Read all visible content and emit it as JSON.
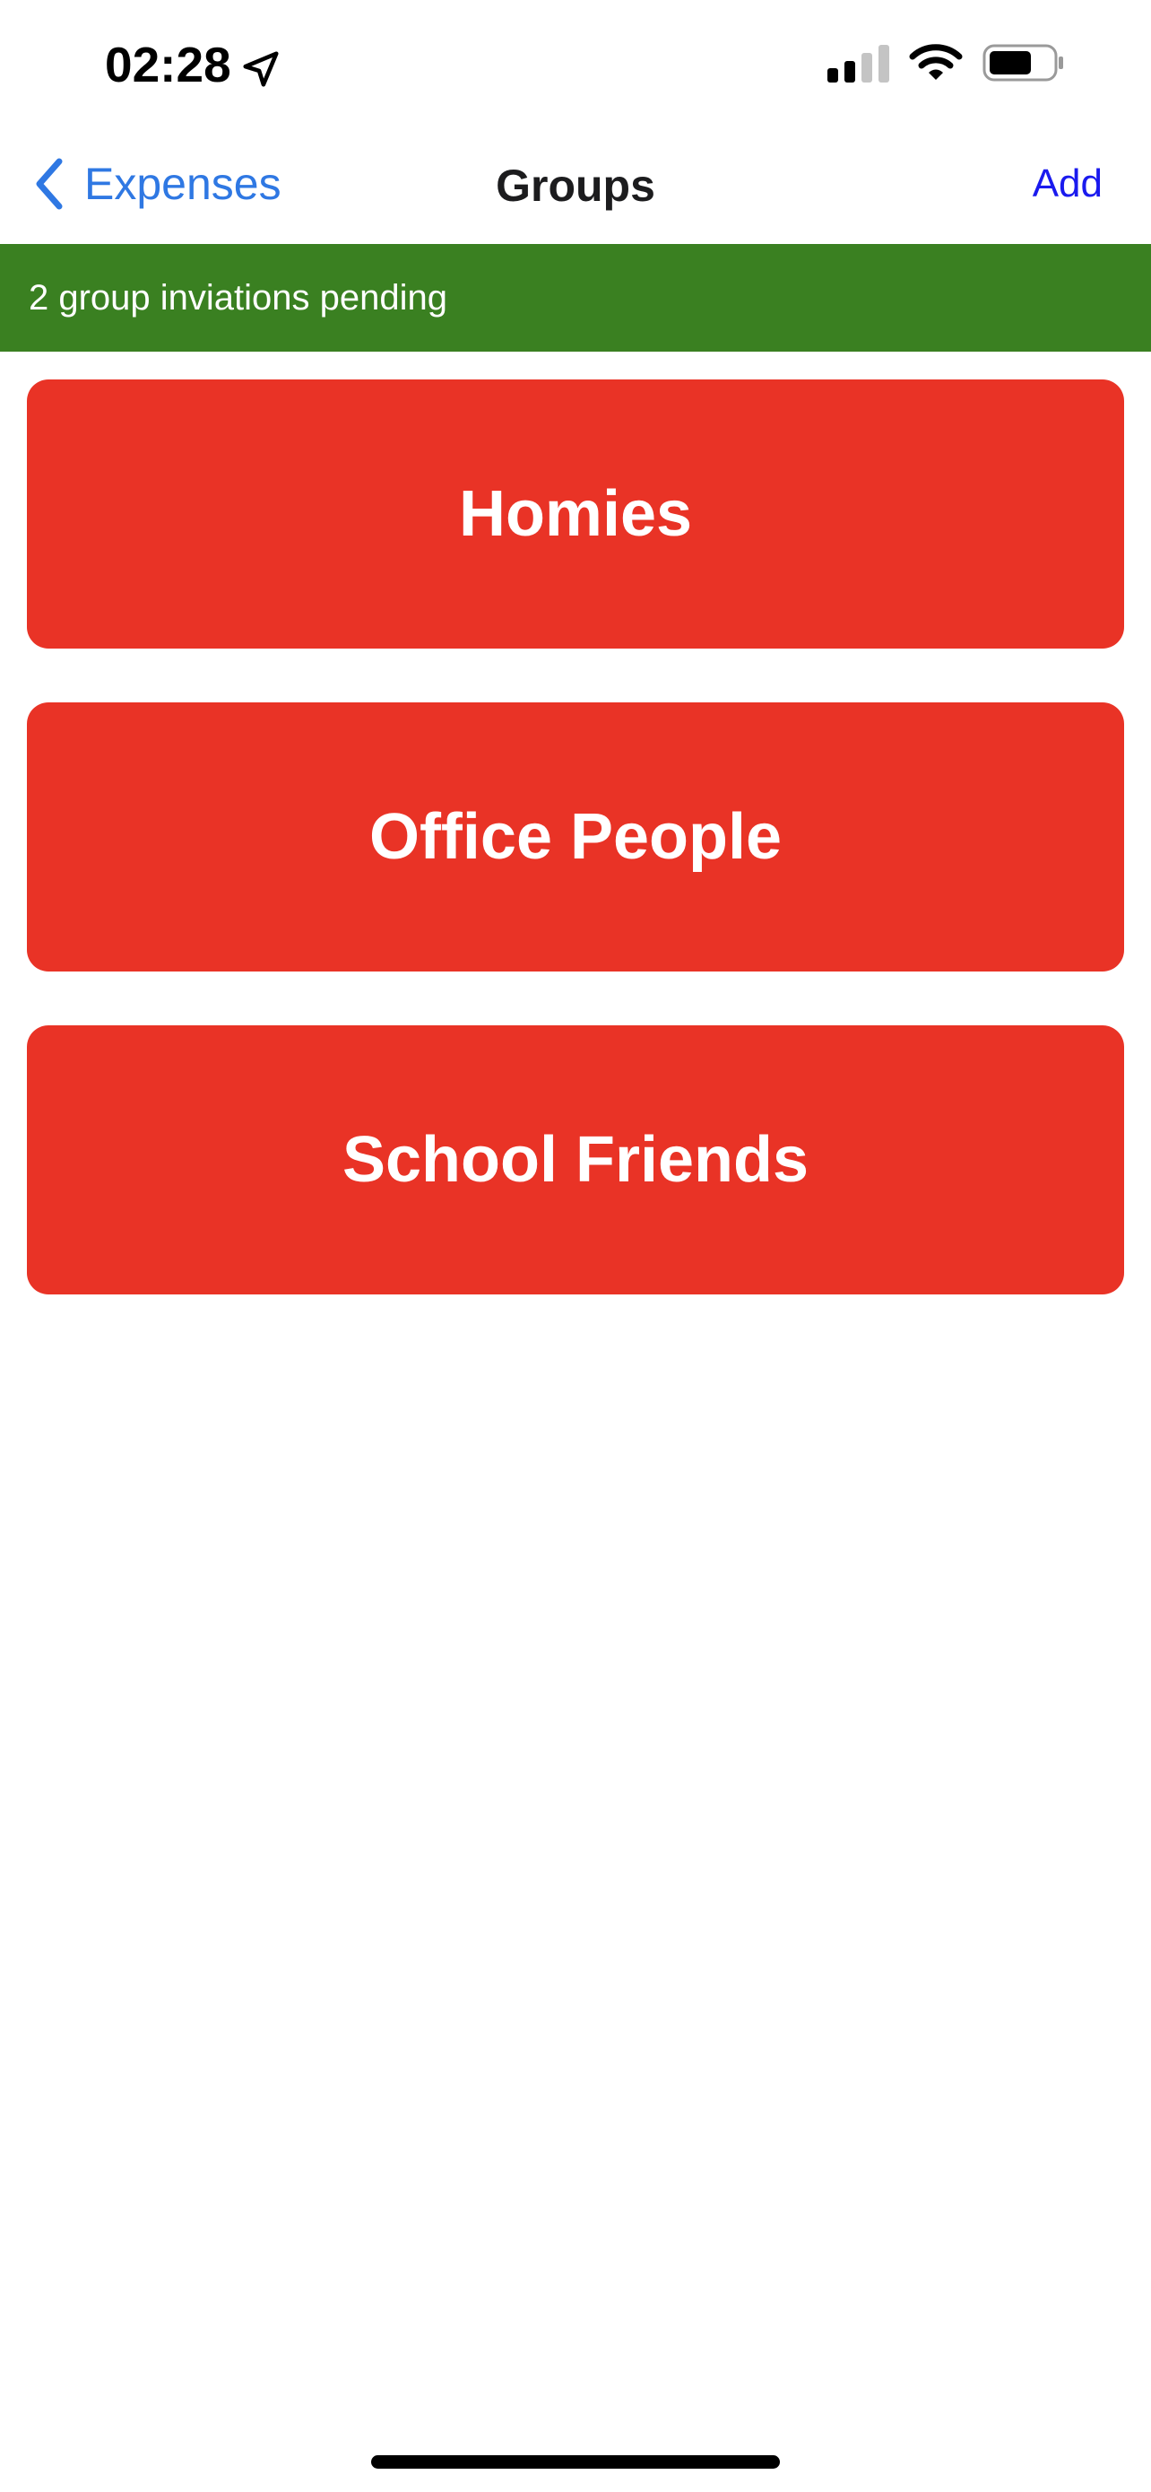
{
  "status_bar": {
    "time": "02:28",
    "location_icon": "location-arrow-icon",
    "signal_icon": "cellular-signal-icon",
    "wifi_icon": "wifi-icon",
    "battery_icon": "battery-icon",
    "battery_level": 0.6,
    "signal_bars_active": 2,
    "signal_bars_total": 4
  },
  "nav": {
    "back_label": "Expenses",
    "title": "Groups",
    "add_label": "Add",
    "back_icon": "chevron-left-icon"
  },
  "banner": {
    "text": "2 group inviations pending",
    "color": "#3a8021"
  },
  "groups": [
    {
      "name": "Homies"
    },
    {
      "name": "Office People"
    },
    {
      "name": "School Friends"
    }
  ],
  "colors": {
    "card": "#e93326",
    "link": "#2f78e3",
    "add": "#1a1aee"
  }
}
